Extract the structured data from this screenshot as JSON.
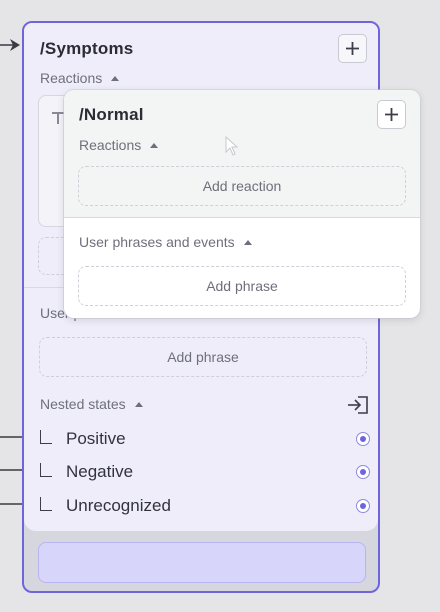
{
  "state": {
    "title": "/Symptoms",
    "reactions_label": "Reactions",
    "phrases_label_partial": "User p",
    "add_phrase_label": "Add phrase",
    "nested_label": "Nested states",
    "nested": [
      {
        "name": "Positive"
      },
      {
        "name": "Negative"
      },
      {
        "name": "Unrecognized"
      }
    ]
  },
  "popup": {
    "title": "/Normal",
    "reactions_label": "Reactions",
    "add_reaction_label": "Add reaction",
    "phrases_label": "User phrases and events",
    "add_phrase_label": "Add phrase"
  },
  "colors": {
    "accent": "#6e65dc",
    "canvas": "#e5e5e8",
    "card": "#eeedf9",
    "footer": "#d8d5fb"
  },
  "icons": {
    "plus": "plus-icon",
    "enter": "enter-icon",
    "caret": "caret-up-icon",
    "radio": "radio-icon"
  }
}
